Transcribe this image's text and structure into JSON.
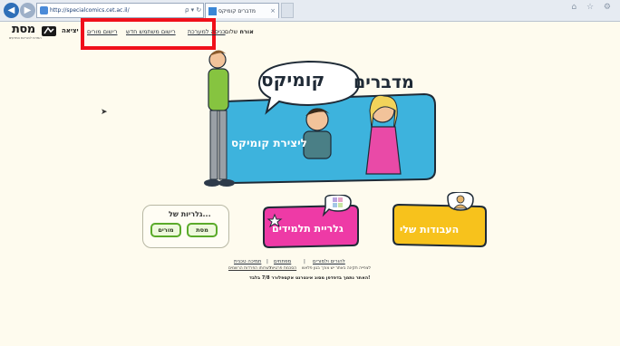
{
  "browser": {
    "address": "http://specialcomics.cet.ac.il/",
    "address_tools": "ρ ▾ ↻",
    "tab_title": "מדברים קומיקס",
    "tab_close": "×",
    "window_icons": "⌂ ☆ ⚙"
  },
  "site": {
    "logo_text": "מסת",
    "logo_sub": "המרכז להוראת המדעים",
    "exit_label": "יציאה",
    "nav": {
      "teacher_registration": "רישום מורים",
      "new_user_registration": "רישום משתמש חדש",
      "system_login": "כניסה למערכת"
    },
    "greeting_prefix": "שלום",
    "greeting_user": "אורח"
  },
  "hero": {
    "title_main": "מדברים",
    "title_bubble": "קומיקס",
    "create_label": "ליצירת קומיקס"
  },
  "gallery": {
    "title": "גלריות של...",
    "teachers_btn": "מורים",
    "massat_btn": "מסת"
  },
  "buttons": {
    "students_gallery": "גלריית תלמידים",
    "my_works": "העבודות שלי"
  },
  "footer": {
    "for_teachers": "להורים ולמורים",
    "partners": "מפתחים",
    "tech_support": "תמיכה טכנית",
    "separator": "|",
    "help_text": "לצפייה תקינה באתר יש צורך בגון פלאש",
    "privacy": "הסכמת פרטיות",
    "terms": "לשרותו הפרדות הרשמים",
    "browser_note": "האתר נתמך בדפדפן מסוג אינטרנט אקספלורר 7/8 בלבד!"
  },
  "colors": {
    "background": "#fefbee",
    "highlight": "#f0101a",
    "hero_blue": "#3db3dd",
    "students_pink": "#ee3aa6",
    "mywork_yellow": "#f7c21c",
    "gallery_green": "#5aaa2a"
  }
}
